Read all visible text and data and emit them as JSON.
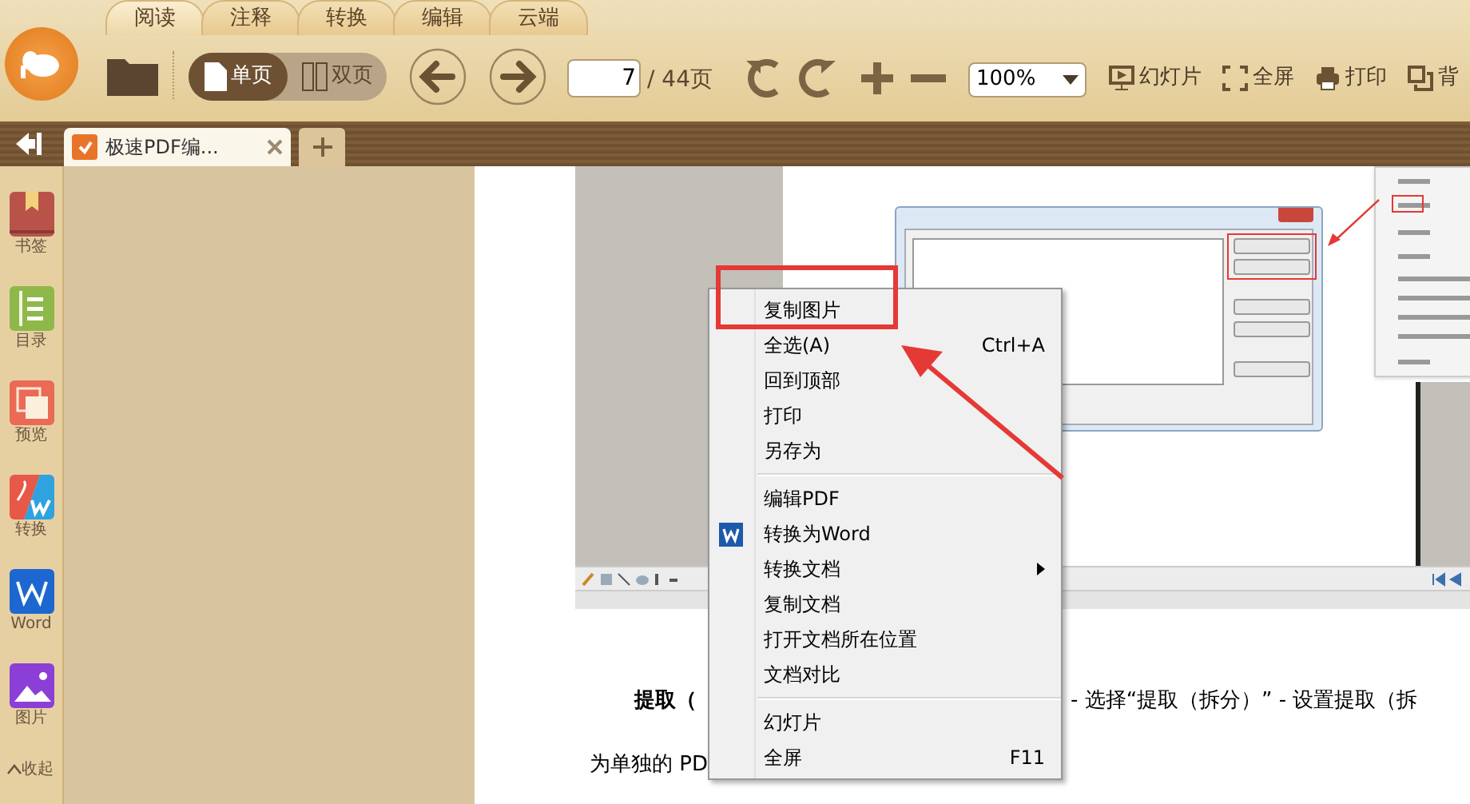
{
  "ribbon_tabs": [
    {
      "label": "阅读",
      "selected": true
    },
    {
      "label": "注释",
      "selected": false
    },
    {
      "label": "转换",
      "selected": false
    },
    {
      "label": "编辑",
      "selected": false
    },
    {
      "label": "云端",
      "selected": false
    }
  ],
  "toolbar": {
    "view_modes": [
      {
        "label": "单页",
        "kind": "single",
        "selected": true
      },
      {
        "label": "双页",
        "kind": "double",
        "selected": false
      }
    ],
    "page_number": "7",
    "page_total": "/ 44页",
    "zoom": "100%",
    "actions": [
      {
        "label": "幻灯片",
        "kind": "slideshow"
      },
      {
        "label": "全屏",
        "kind": "fullscreen"
      },
      {
        "label": "打印",
        "kind": "print"
      },
      {
        "label": "背",
        "kind": "background"
      }
    ]
  },
  "doc_tabs": [
    {
      "title": "极速PDF编...",
      "selected": true
    }
  ],
  "sidebar": {
    "items": [
      {
        "label": "书签",
        "kind": "bookmark"
      },
      {
        "label": "目录",
        "kind": "toc"
      },
      {
        "label": "预览",
        "kind": "preview"
      },
      {
        "label": "转换",
        "kind": "convert"
      },
      {
        "label": "Word",
        "kind": "word"
      },
      {
        "label": "图片",
        "kind": "image"
      }
    ],
    "collapse": "收起"
  },
  "paragraph": {
    "line_1_left": "提取（",
    "line_1_right": "- 选择“提取（拆分）” - 设置提取（拆",
    "line_2": "为单独的 PD"
  },
  "context_menu": {
    "sections": [
      [
        {
          "label": "复制图片",
          "kind": "plain",
          "submenu": false,
          "boxed": true
        },
        {
          "label": "全选(A)",
          "shortcut": "Ctrl+A",
          "kind": "plain",
          "submenu": false,
          "boxed": false
        },
        {
          "label": "回到顶部",
          "kind": "plain",
          "submenu": false,
          "boxed": false
        },
        {
          "label": "打印",
          "kind": "plain",
          "submenu": false,
          "boxed": false
        },
        {
          "label": "另存为",
          "kind": "plain",
          "submenu": false,
          "boxed": false
        }
      ],
      [
        {
          "label": "编辑PDF",
          "kind": "plain",
          "submenu": false,
          "boxed": false
        },
        {
          "label": "转换为Word",
          "kind": "word",
          "submenu": false,
          "boxed": false
        },
        {
          "label": "转换文档",
          "kind": "plain",
          "submenu": true,
          "boxed": false
        },
        {
          "label": "复制文档",
          "kind": "plain",
          "submenu": false,
          "boxed": false
        },
        {
          "label": "打开文档所在位置",
          "kind": "plain",
          "submenu": false,
          "boxed": false
        },
        {
          "label": "文档对比",
          "kind": "plain",
          "submenu": false,
          "boxed": false
        }
      ],
      [
        {
          "label": "幻灯片",
          "kind": "plain",
          "submenu": false,
          "boxed": false
        },
        {
          "label": "全屏",
          "shortcut": "F11",
          "kind": "plain",
          "submenu": false,
          "boxed": false
        }
      ]
    ]
  }
}
